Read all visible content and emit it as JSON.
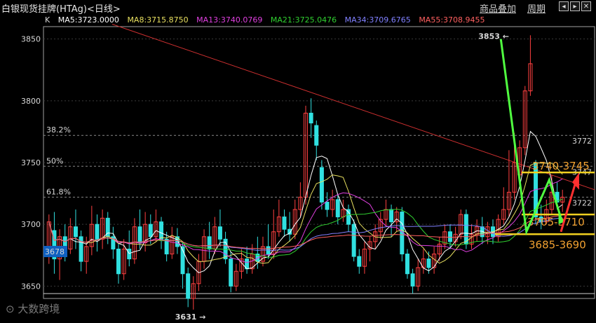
{
  "header": {
    "title": "白银现货挂牌(HTAg)<日线>",
    "overlay_link": "商品叠加",
    "period_link": "周期"
  },
  "legend": {
    "k_label": "K",
    "items": [
      {
        "name": "MA5",
        "text": "MA5:3723.0000",
        "color": "#ffffff"
      },
      {
        "name": "MA8",
        "text": "MA8:3715.8750",
        "color": "#e8e060"
      },
      {
        "name": "MA13",
        "text": "MA13:3740.0769",
        "color": "#e040e0"
      },
      {
        "name": "MA21",
        "text": "MA21:3725.0476",
        "color": "#30d030"
      },
      {
        "name": "MA34",
        "text": "MA34:3709.6765",
        "color": "#8080ff"
      },
      {
        "name": "MA55",
        "text": "MA55:3708.9455",
        "color": "#ff6060"
      }
    ]
  },
  "watermark": "大数跨境",
  "chart_data": {
    "type": "candlestick",
    "ylim": [
      3640,
      3860
    ],
    "y_ticks": [
      3650,
      3700,
      3750,
      3800,
      3850
    ],
    "fib_levels": [
      {
        "label": "38.2%",
        "value": 3772,
        "right_label": "3772"
      },
      {
        "label": "50%",
        "value": 3747,
        "right_label": "3747"
      },
      {
        "label": "61.8%",
        "value": 3722,
        "right_label": "3722"
      }
    ],
    "price_tag": "3678",
    "high_mark": "3853",
    "low_mark": "3631",
    "annotations": {
      "resistance": "3740-3745",
      "support1": "3705-3710",
      "support2": "3685-3690"
    },
    "candles": [
      {
        "o": 3680,
        "c": 3702,
        "h": 3708,
        "l": 3668
      },
      {
        "o": 3695,
        "c": 3672,
        "h": 3710,
        "l": 3660
      },
      {
        "o": 3672,
        "c": 3690,
        "h": 3696,
        "l": 3655
      },
      {
        "o": 3690,
        "c": 3680,
        "h": 3700,
        "l": 3670
      },
      {
        "o": 3680,
        "c": 3698,
        "h": 3705,
        "l": 3676
      },
      {
        "o": 3698,
        "c": 3690,
        "h": 3712,
        "l": 3680
      },
      {
        "o": 3690,
        "c": 3670,
        "h": 3695,
        "l": 3662
      },
      {
        "o": 3670,
        "c": 3682,
        "h": 3690,
        "l": 3660
      },
      {
        "o": 3682,
        "c": 3700,
        "h": 3715,
        "l": 3675
      },
      {
        "o": 3700,
        "c": 3688,
        "h": 3708,
        "l": 3678
      },
      {
        "o": 3688,
        "c": 3705,
        "h": 3712,
        "l": 3680
      },
      {
        "o": 3705,
        "c": 3690,
        "h": 3710,
        "l": 3684
      },
      {
        "o": 3690,
        "c": 3680,
        "h": 3698,
        "l": 3672
      },
      {
        "o": 3680,
        "c": 3660,
        "h": 3685,
        "l": 3652
      },
      {
        "o": 3660,
        "c": 3680,
        "h": 3688,
        "l": 3655
      },
      {
        "o": 3680,
        "c": 3672,
        "h": 3695,
        "l": 3666
      },
      {
        "o": 3672,
        "c": 3698,
        "h": 3705,
        "l": 3668
      },
      {
        "o": 3698,
        "c": 3685,
        "h": 3712,
        "l": 3680
      },
      {
        "o": 3685,
        "c": 3700,
        "h": 3710,
        "l": 3678
      },
      {
        "o": 3700,
        "c": 3690,
        "h": 3708,
        "l": 3684
      },
      {
        "o": 3690,
        "c": 3702,
        "h": 3712,
        "l": 3686
      },
      {
        "o": 3702,
        "c": 3688,
        "h": 3706,
        "l": 3680
      },
      {
        "o": 3688,
        "c": 3676,
        "h": 3694,
        "l": 3670
      },
      {
        "o": 3676,
        "c": 3690,
        "h": 3698,
        "l": 3672
      },
      {
        "o": 3690,
        "c": 3682,
        "h": 3697,
        "l": 3676
      },
      {
        "o": 3682,
        "c": 3660,
        "h": 3686,
        "l": 3648
      },
      {
        "o": 3660,
        "c": 3640,
        "h": 3665,
        "l": 3633
      },
      {
        "o": 3640,
        "c": 3652,
        "h": 3658,
        "l": 3631
      },
      {
        "o": 3652,
        "c": 3670,
        "h": 3676,
        "l": 3646
      },
      {
        "o": 3670,
        "c": 3690,
        "h": 3696,
        "l": 3664
      },
      {
        "o": 3690,
        "c": 3680,
        "h": 3702,
        "l": 3672
      },
      {
        "o": 3680,
        "c": 3698,
        "h": 3706,
        "l": 3676
      },
      {
        "o": 3698,
        "c": 3688,
        "h": 3712,
        "l": 3682
      },
      {
        "o": 3688,
        "c": 3672,
        "h": 3694,
        "l": 3668
      },
      {
        "o": 3672,
        "c": 3650,
        "h": 3678,
        "l": 3645
      },
      {
        "o": 3650,
        "c": 3662,
        "h": 3668,
        "l": 3646
      },
      {
        "o": 3662,
        "c": 3672,
        "h": 3680,
        "l": 3656
      },
      {
        "o": 3672,
        "c": 3664,
        "h": 3682,
        "l": 3660
      },
      {
        "o": 3664,
        "c": 3676,
        "h": 3684,
        "l": 3660
      },
      {
        "o": 3676,
        "c": 3670,
        "h": 3690,
        "l": 3664
      },
      {
        "o": 3670,
        "c": 3682,
        "h": 3690,
        "l": 3666
      },
      {
        "o": 3682,
        "c": 3676,
        "h": 3700,
        "l": 3672
      },
      {
        "o": 3676,
        "c": 3694,
        "h": 3712,
        "l": 3672
      },
      {
        "o": 3694,
        "c": 3706,
        "h": 3720,
        "l": 3690
      },
      {
        "o": 3706,
        "c": 3696,
        "h": 3712,
        "l": 3690
      },
      {
        "o": 3696,
        "c": 3692,
        "h": 3710,
        "l": 3686
      },
      {
        "o": 3692,
        "c": 3712,
        "h": 3720,
        "l": 3688
      },
      {
        "o": 3712,
        "c": 3722,
        "h": 3734,
        "l": 3706
      },
      {
        "o": 3722,
        "c": 3790,
        "h": 3796,
        "l": 3716
      },
      {
        "o": 3790,
        "c": 3782,
        "h": 3802,
        "l": 3770
      },
      {
        "o": 3780,
        "c": 3764,
        "h": 3784,
        "l": 3752
      },
      {
        "o": 3746,
        "c": 3718,
        "h": 3752,
        "l": 3712
      },
      {
        "o": 3718,
        "c": 3712,
        "h": 3726,
        "l": 3706
      },
      {
        "o": 3712,
        "c": 3720,
        "h": 3728,
        "l": 3706
      },
      {
        "o": 3720,
        "c": 3706,
        "h": 3724,
        "l": 3700
      },
      {
        "o": 3706,
        "c": 3712,
        "h": 3720,
        "l": 3702
      },
      {
        "o": 3712,
        "c": 3700,
        "h": 3716,
        "l": 3694
      },
      {
        "o": 3700,
        "c": 3674,
        "h": 3704,
        "l": 3670
      },
      {
        "o": 3674,
        "c": 3666,
        "h": 3680,
        "l": 3660
      },
      {
        "o": 3666,
        "c": 3680,
        "h": 3686,
        "l": 3660
      },
      {
        "o": 3680,
        "c": 3686,
        "h": 3690,
        "l": 3670
      },
      {
        "o": 3686,
        "c": 3694,
        "h": 3700,
        "l": 3680
      },
      {
        "o": 3694,
        "c": 3704,
        "h": 3710,
        "l": 3688
      },
      {
        "o": 3704,
        "c": 3712,
        "h": 3720,
        "l": 3698
      },
      {
        "o": 3712,
        "c": 3702,
        "h": 3716,
        "l": 3690
      },
      {
        "o": 3702,
        "c": 3710,
        "h": 3714,
        "l": 3694
      },
      {
        "o": 3710,
        "c": 3676,
        "h": 3714,
        "l": 3670
      },
      {
        "o": 3676,
        "c": 3660,
        "h": 3680,
        "l": 3656
      },
      {
        "o": 3660,
        "c": 3650,
        "h": 3664,
        "l": 3644
      },
      {
        "o": 3650,
        "c": 3665,
        "h": 3672,
        "l": 3646
      },
      {
        "o": 3665,
        "c": 3672,
        "h": 3680,
        "l": 3660
      },
      {
        "o": 3672,
        "c": 3665,
        "h": 3678,
        "l": 3660
      },
      {
        "o": 3665,
        "c": 3676,
        "h": 3682,
        "l": 3660
      },
      {
        "o": 3676,
        "c": 3684,
        "h": 3690,
        "l": 3670
      },
      {
        "o": 3684,
        "c": 3694,
        "h": 3700,
        "l": 3680
      },
      {
        "o": 3694,
        "c": 3686,
        "h": 3700,
        "l": 3680
      },
      {
        "o": 3686,
        "c": 3692,
        "h": 3698,
        "l": 3682
      },
      {
        "o": 3692,
        "c": 3708,
        "h": 3712,
        "l": 3688
      },
      {
        "o": 3708,
        "c": 3684,
        "h": 3712,
        "l": 3680
      },
      {
        "o": 3684,
        "c": 3692,
        "h": 3700,
        "l": 3680
      },
      {
        "o": 3692,
        "c": 3698,
        "h": 3704,
        "l": 3686
      },
      {
        "o": 3698,
        "c": 3690,
        "h": 3706,
        "l": 3684
      },
      {
        "o": 3690,
        "c": 3698,
        "h": 3702,
        "l": 3684
      },
      {
        "o": 3698,
        "c": 3690,
        "h": 3704,
        "l": 3684
      },
      {
        "o": 3690,
        "c": 3704,
        "h": 3708,
        "l": 3686
      },
      {
        "o": 3704,
        "c": 3712,
        "h": 3730,
        "l": 3700
      },
      {
        "o": 3712,
        "c": 3726,
        "h": 3760,
        "l": 3706
      },
      {
        "o": 3726,
        "c": 3750,
        "h": 3774,
        "l": 3720
      },
      {
        "o": 3740,
        "c": 3762,
        "h": 3768,
        "l": 3734
      },
      {
        "o": 3762,
        "c": 3808,
        "h": 3812,
        "l": 3756
      },
      {
        "o": 3808,
        "c": 3830,
        "h": 3853,
        "l": 3804
      },
      {
        "o": 3750,
        "c": 3706,
        "h": 3752,
        "l": 3700
      },
      {
        "o": 3706,
        "c": 3702,
        "h": 3716,
        "l": 3696
      },
      {
        "o": 3702,
        "c": 3712,
        "h": 3720,
        "l": 3700
      },
      {
        "o": 3712,
        "c": 3726,
        "h": 3740,
        "l": 3708
      },
      {
        "o": 3726,
        "c": 3718,
        "h": 3734,
        "l": 3712
      },
      {
        "o": 3718,
        "c": 3722,
        "h": 3728,
        "l": 3710
      }
    ]
  }
}
